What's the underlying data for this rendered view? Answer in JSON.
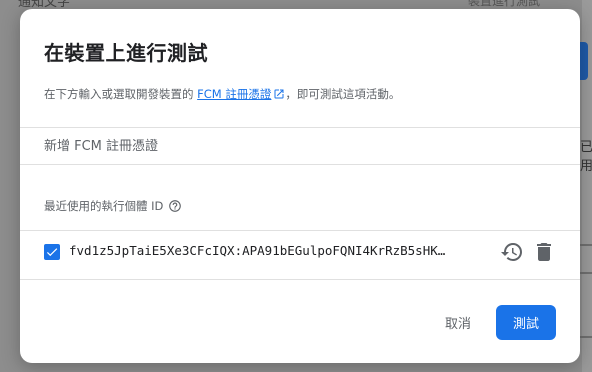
{
  "background": {
    "top_left_text": "通知文字",
    "top_right_text": "裝置進行測試",
    "right_edge_text": "已用"
  },
  "dialog": {
    "title": "在裝置上進行測試",
    "subtitle_before": "在下方輸入或選取開發裝置的 ",
    "subtitle_link": "FCM 註冊憑證",
    "subtitle_after": "，即可測試這項活動。",
    "add_token_placeholder": "新增 FCM 註冊憑證",
    "recent_label": "最近使用的執行個體 ID",
    "tokens": [
      {
        "checked": true,
        "value": "fvd1z5JpTaiE5Xe3CFcIQX:APA91bEGulpoFQNI4KrRzB5sHK…"
      }
    ],
    "cancel_label": "取消",
    "test_label": "測試"
  },
  "colors": {
    "accent": "#1a73e8",
    "text_primary": "#202124",
    "text_secondary": "#5f6368",
    "icon_gray": "#5f6368"
  },
  "icons": {
    "external_link": "open-in-new-icon",
    "help": "help-circle-icon",
    "history": "history-icon",
    "delete": "trash-icon",
    "check": "check-icon"
  }
}
